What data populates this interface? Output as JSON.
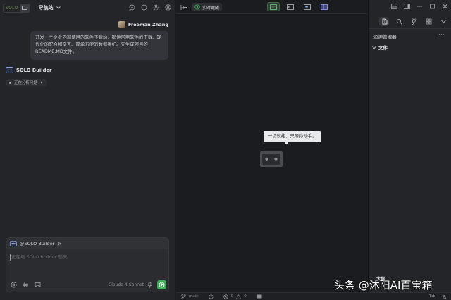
{
  "left": {
    "badge": "SOLO",
    "nav_title": "导航站",
    "user": {
      "name": "Freeman Zhang"
    },
    "user_message": "开发一个企业内部使用的软件下载站，提供常用软件的下载、现代化的配合和交互、简单方便的数据维护。先生成项目的README.MD文件。",
    "bot": {
      "name": "SOLO Builder"
    },
    "status_text": "正在分析问题",
    "chat": {
      "mention": "@SOLO Builder",
      "placeholder": "正在与 SOLO Builder 聊天",
      "model": "Claude-4-Sonnet"
    }
  },
  "mid": {
    "live_tab": "实时跟随",
    "empty_tip": "一切就绪，只等你动手。"
  },
  "right": {
    "title": "资源管理器",
    "more": "···",
    "folder": "文件",
    "outline": "大纲"
  },
  "status_bar": {
    "branch": "main",
    "errors": "0",
    "warnings": "0",
    "tab": "Tab"
  },
  "watermark": "头条 @沐阳AI百宝箱",
  "colors": {
    "accent_green": "#3fae5a",
    "bot_blue": "#8aa0d8",
    "panel": "#242528",
    "canvas": "#1b1c1f"
  }
}
